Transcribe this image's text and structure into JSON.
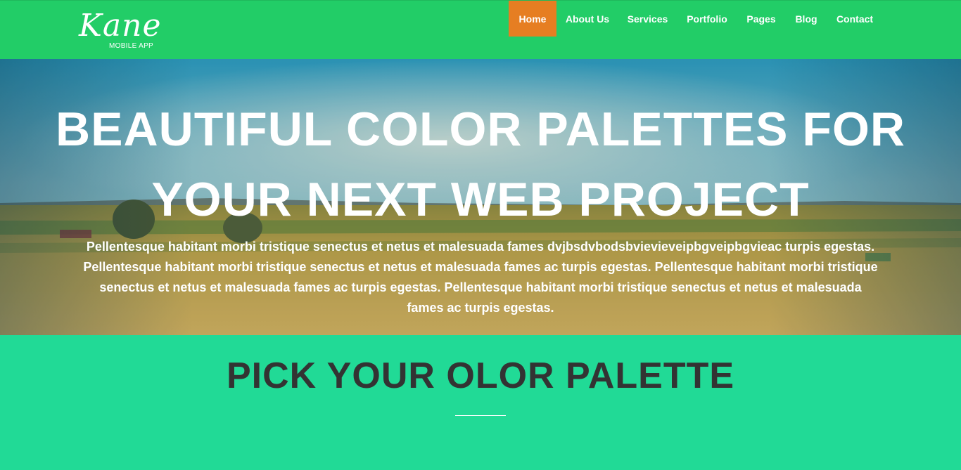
{
  "brand": {
    "logo_text": "Kane",
    "logo_subtitle": "MOBILE APP"
  },
  "nav": {
    "items": [
      {
        "label": "Home",
        "active": true
      },
      {
        "label": "About Us",
        "active": false
      },
      {
        "label": "Services",
        "active": false
      },
      {
        "label": "Portfolio",
        "active": false
      },
      {
        "label": "Pages",
        "active": false
      },
      {
        "label": "Blog",
        "active": false
      },
      {
        "label": "Contact",
        "active": false
      }
    ]
  },
  "hero": {
    "title_line1": "BEAUTIFUL COLOR PALETTES FOR",
    "title_line2": "YOUR NEXT WEB PROJECT",
    "text": "Pellentesque habitant morbi tristique senectus et netus et malesuada fames dvjbsdvbodsbvievieveipbgveipbgvieac turpis egestas. Pellentesque habitant morbi tristique senectus et netus et malesuada fames ac turpis egestas. Pellentesque habitant morbi tristique senectus et netus et malesuada fames ac turpis egestas. Pellentesque habitant morbi tristique senectus et netus et malesuada fames ac turpis egestas."
  },
  "section": {
    "title": "PICK YOUR OLOR PALETTE"
  },
  "colors": {
    "header_bg": "#22cd67",
    "active_nav": "#e67e22",
    "section_bg": "#21da96",
    "section_title": "#333333"
  }
}
